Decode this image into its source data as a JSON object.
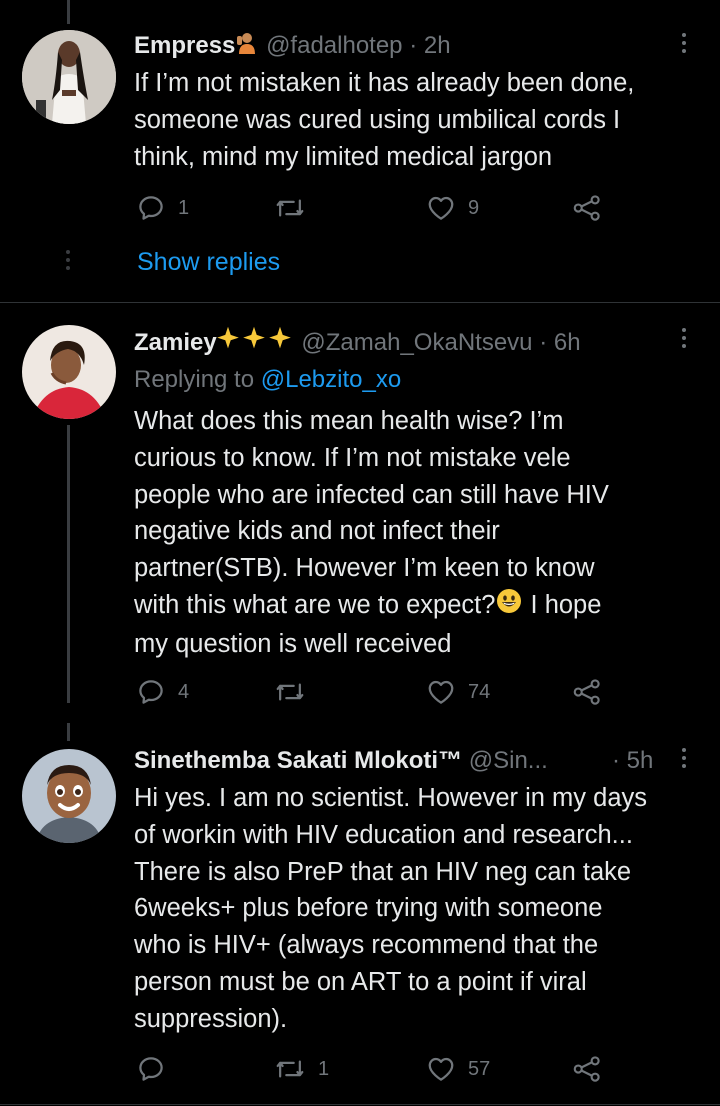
{
  "tweets": [
    {
      "name": "Empress",
      "name_emoji": "person-gesturing-emoji",
      "handle": "@fadalhotep",
      "sep": "·",
      "time": "2h",
      "lines": [
        "If I’m not mistaken it has already been done,",
        "someone was cured using umbilical cords I",
        "think, mind my limited medical jargon"
      ],
      "replies": "1",
      "retweets": "",
      "likes": "9",
      "show_replies": "Show replies"
    },
    {
      "name": "Zamiey",
      "name_emoji": "sparkles-emoji",
      "handle": "@Zamah_OkaNtsevu",
      "sep": "·",
      "time": "6h",
      "replying_prefix": "Replying to",
      "replying_to": "@Lebzito_xo",
      "lines": [
        "What does this mean health wise? I’m",
        "curious to know. If I’m not mistake vele",
        "people who are infected can still have HIV",
        "negative kids and not infect their",
        "partner(STB). However I’m keen to know",
        "with this what are we to expect?",
        "my question is well received"
      ],
      "line6_tail": " I hope",
      "replies": "4",
      "retweets": "",
      "likes": "74"
    },
    {
      "name": "Sinethemba Sakati Mlokoti™",
      "handle": "@Sin...",
      "sep": "·",
      "time": "5h",
      "lines": [
        "Hi yes. I am no scientist. However in my days",
        "of workin with HIV education and research...",
        "There is also PreP that an HIV neg can take",
        "6weeks+ plus before trying with someone",
        "who is HIV+ (always recommend that the",
        "person must be on ART to a point if viral",
        "suppression)."
      ],
      "replies": "",
      "retweets": "1",
      "likes": "57"
    }
  ],
  "icons": {
    "reply": "reply-icon",
    "retweet": "retweet-icon",
    "like": "heart-icon",
    "share": "share-icon",
    "more": "more-options-icon"
  },
  "colors": {
    "background": "#000000",
    "text": "#e7e9ea",
    "muted": "#71767b",
    "link": "#1d9bf0",
    "divider": "#2f3336"
  }
}
